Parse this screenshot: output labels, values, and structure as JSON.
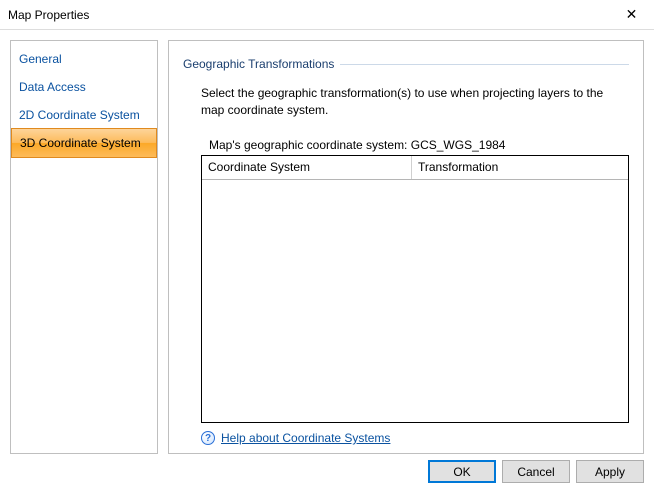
{
  "window": {
    "title": "Map Properties",
    "close_glyph": "✕"
  },
  "sidebar": {
    "items": [
      {
        "label": "General"
      },
      {
        "label": "Data Access"
      },
      {
        "label": "2D Coordinate System"
      },
      {
        "label": "3D Coordinate System"
      }
    ],
    "active_index": 3
  },
  "section": {
    "heading": "Geographic Transformations",
    "description": "Select the geographic transformation(s) to use when projecting layers to the map coordinate system.",
    "gcs_label": "Map's geographic coordinate system:",
    "gcs_value": "GCS_WGS_1984",
    "table": {
      "columns": [
        "Coordinate System",
        "Transformation"
      ],
      "rows": []
    },
    "help_link": "Help about Coordinate Systems",
    "help_icon_glyph": "?"
  },
  "buttons": {
    "ok": "OK",
    "cancel": "Cancel",
    "apply": "Apply"
  }
}
